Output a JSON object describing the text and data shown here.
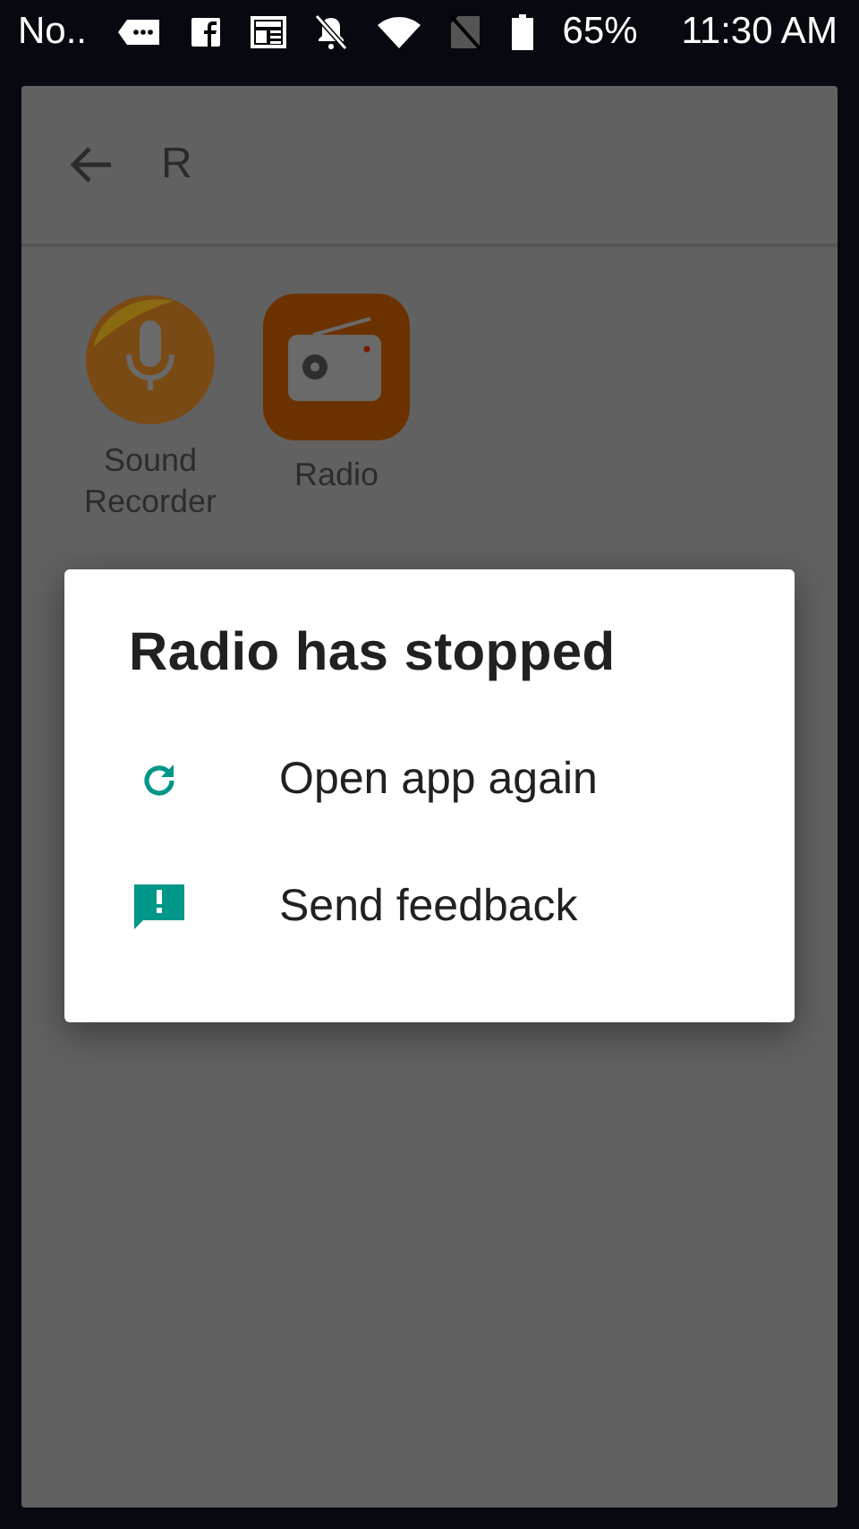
{
  "status_bar": {
    "notification_text": "No..",
    "battery": "65%",
    "time": "11:30 AM"
  },
  "search_bar": {
    "query": "R"
  },
  "apps": [
    {
      "name": "Sound Recorder",
      "kind": "recorder"
    },
    {
      "name": "Radio",
      "kind": "radio"
    }
  ],
  "dialog": {
    "title": "Radio has stopped",
    "actions": [
      {
        "label": "Open app again",
        "kind": "reopen"
      },
      {
        "label": "Send feedback",
        "kind": "feedback"
      }
    ]
  }
}
